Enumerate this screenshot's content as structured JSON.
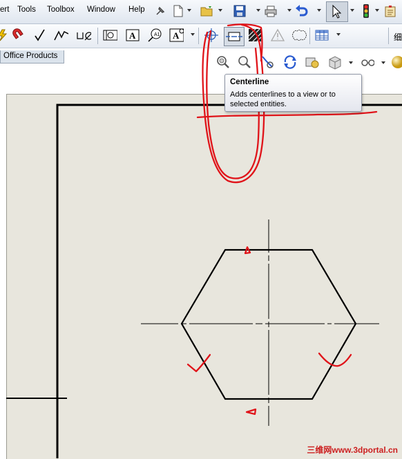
{
  "menubar": {
    "items": [
      "ert",
      "Tools",
      "Toolbox",
      "Window",
      "Help"
    ]
  },
  "tabs": {
    "office_products": "Office Products"
  },
  "tooltip": {
    "title": "Centerline",
    "description": "Adds centerlines to a view or to selected entities."
  },
  "toolbar_cut_text": "细",
  "watermark": "三维网www.3dportal.cn",
  "colors": {
    "annotation_red": "#e0141a",
    "sheet": "#e8e6dd",
    "menubar": "#dfe6ef"
  }
}
